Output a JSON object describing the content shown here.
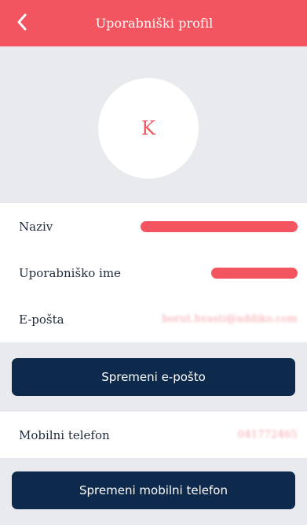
{
  "header": {
    "title": "Uporabniški profil",
    "back_icon": "chevron-left-icon"
  },
  "avatar": {
    "initial": "K"
  },
  "fields": [
    {
      "label": "Naziv",
      "value": ""
    },
    {
      "label": "Uporabniško ime",
      "value": ""
    },
    {
      "label": "E-pošta",
      "value": "borut.hvasti@addiko.com"
    }
  ],
  "buttons": {
    "save_email": "Spremeni e-pošto",
    "save_mobile": "Spremeni mobilni telefon"
  },
  "mobile": {
    "label": "Mobilni telefon",
    "value": "041772465"
  },
  "colors": {
    "accent": "#f2555f",
    "button_bg": "#0d2a4c",
    "background": "#e8eaed"
  }
}
